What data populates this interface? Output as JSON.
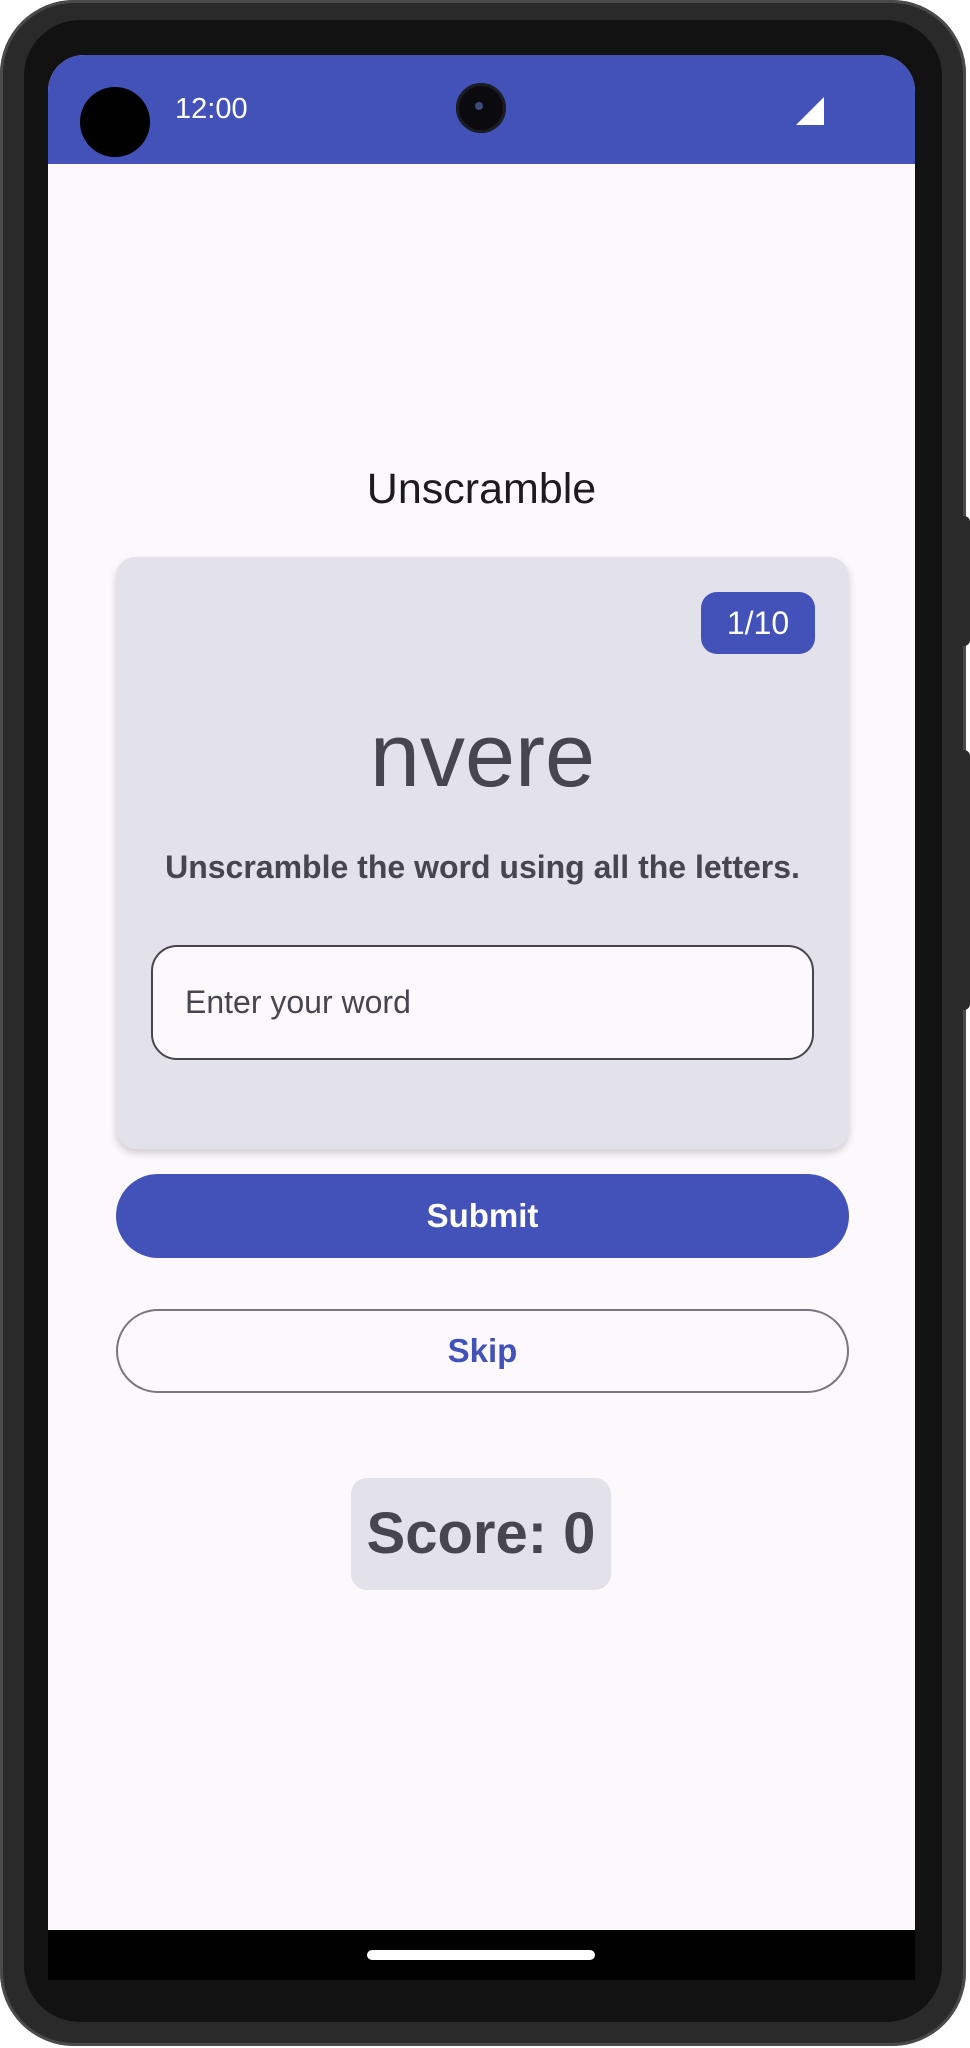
{
  "status_bar": {
    "time": "12:00",
    "signal_icon": "signal-icon"
  },
  "app": {
    "title": "Unscramble"
  },
  "game_card": {
    "word_count": "1/10",
    "scrambled_word": "nvere",
    "instructions": "Unscramble the word using all the letters.",
    "input_placeholder": "Enter your word",
    "input_value": ""
  },
  "actions": {
    "submit_label": "Submit",
    "skip_label": "Skip"
  },
  "score": {
    "label": "Score: 0"
  },
  "colors": {
    "primary": "#4252b8",
    "surface": "#fcf8fc",
    "card": "#e3e1ea",
    "on_surface_variant": "#47464f"
  }
}
